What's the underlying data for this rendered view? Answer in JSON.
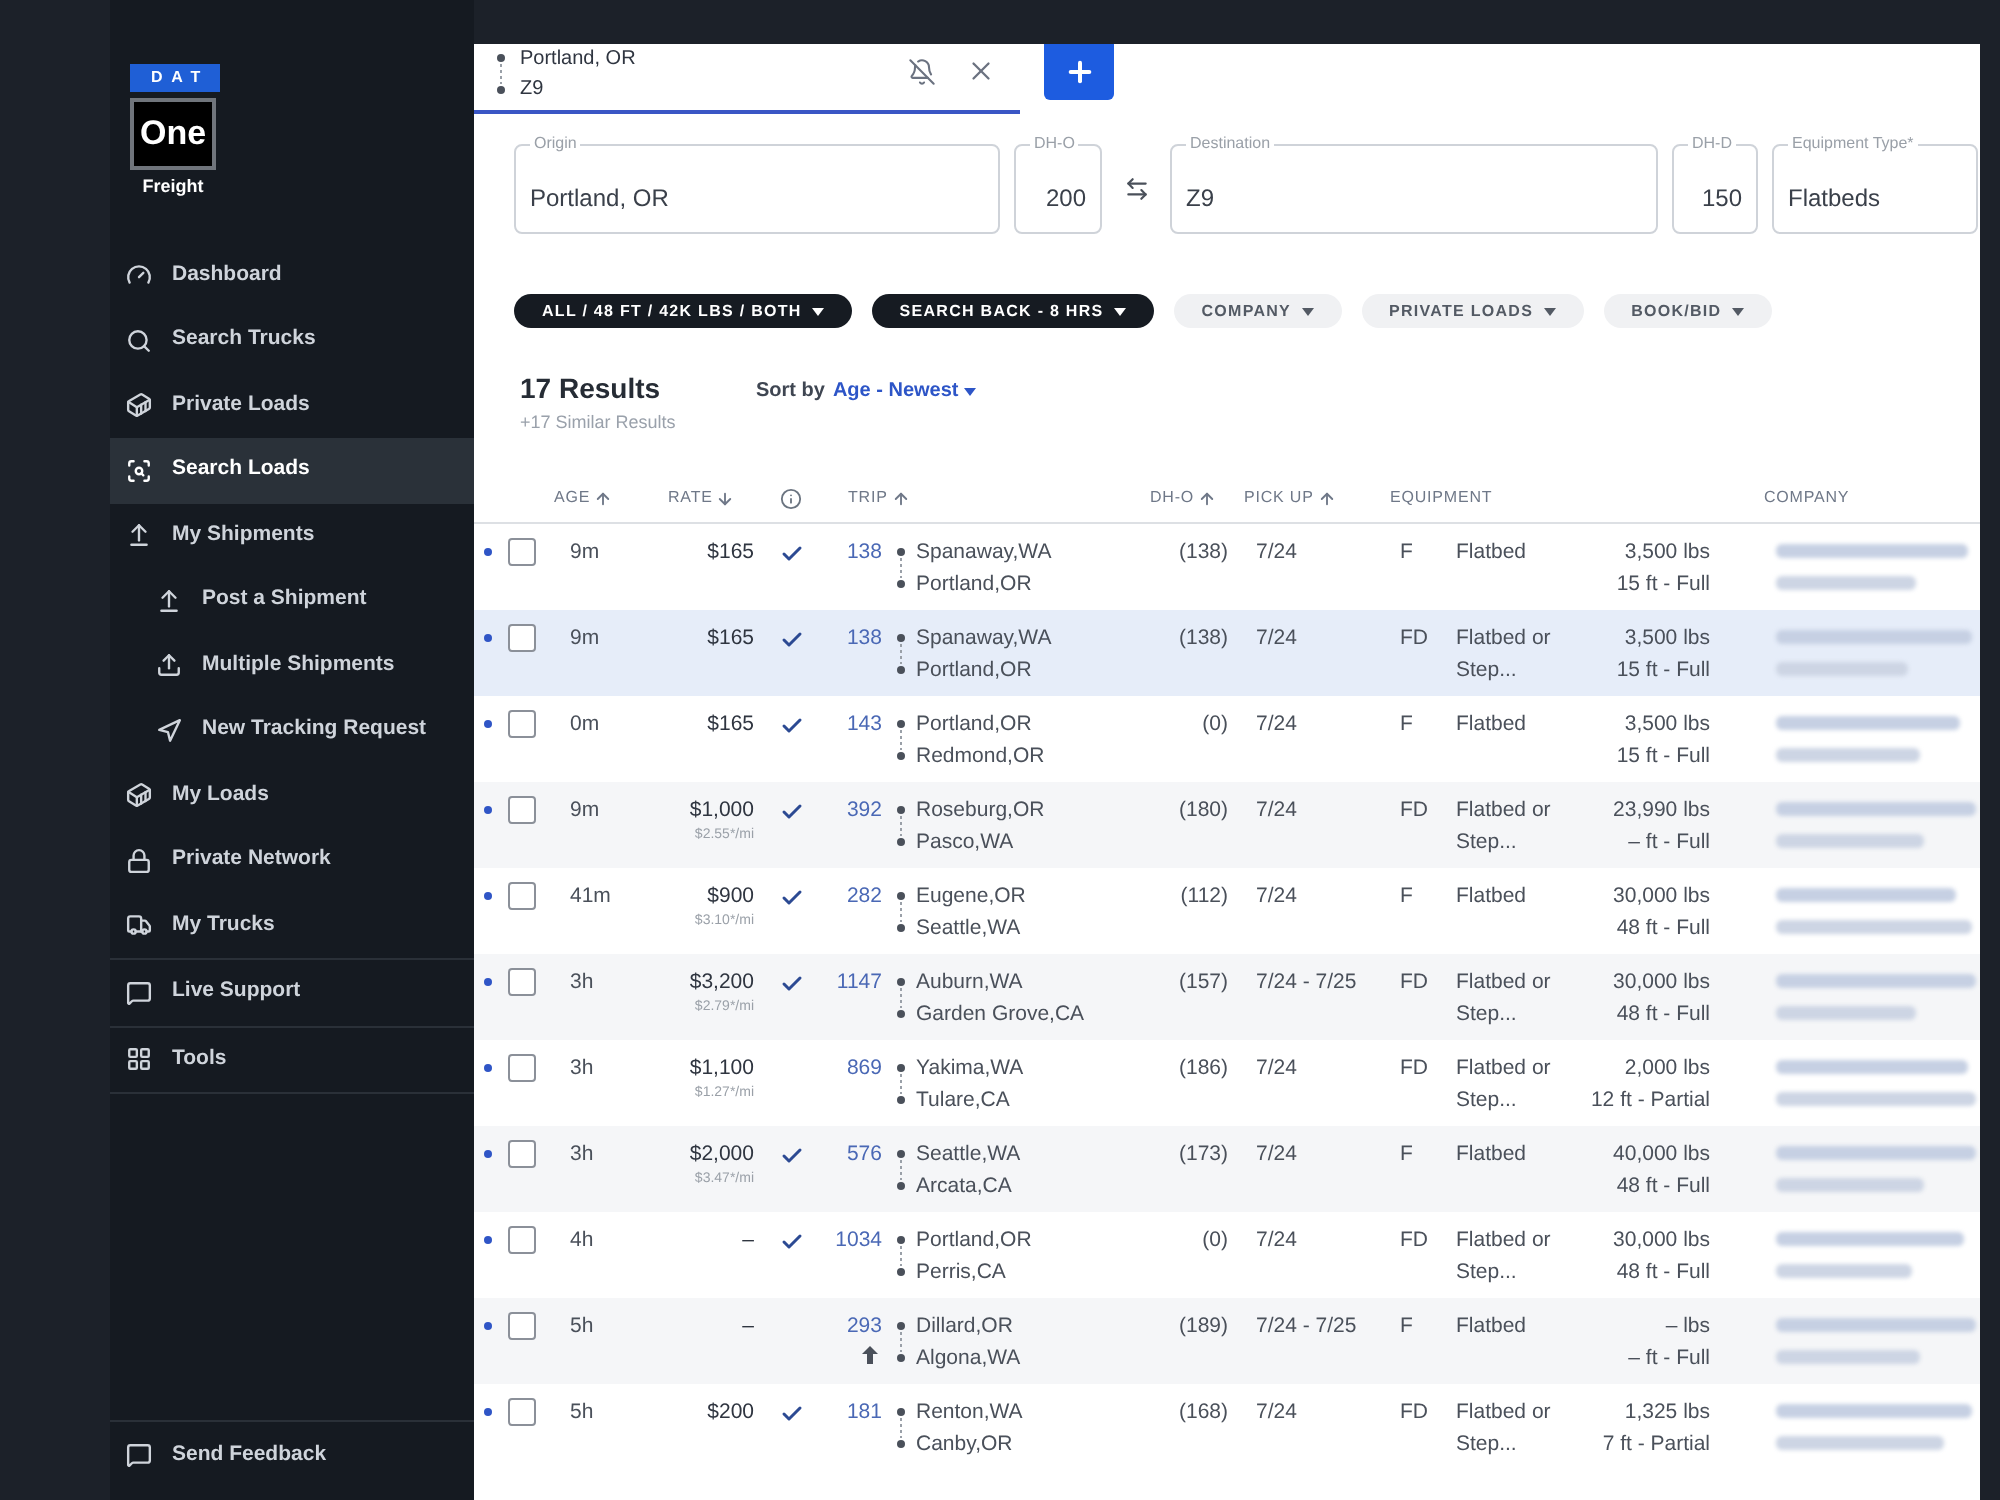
{
  "logo": {
    "brand": "DAT",
    "product": "One",
    "tagline": "Freight"
  },
  "sidebar": {
    "sections": [
      {
        "items": [
          {
            "label": "Dashboard",
            "selected": false
          },
          {
            "label": "Search Trucks",
            "selected": false
          },
          {
            "label": "Private Loads",
            "selected": false
          },
          {
            "label": "Search Loads",
            "selected": true
          },
          {
            "label": "My Shipments",
            "selected": false,
            "children": [
              {
                "label": "Post a Shipment",
                "selected": false
              },
              {
                "label": "Multiple Shipments",
                "selected": false
              },
              {
                "label": "New Tracking Request",
                "selected": false
              }
            ]
          },
          {
            "label": "My Loads",
            "selected": false
          },
          {
            "label": "Private Network",
            "selected": false
          },
          {
            "label": "My Trucks",
            "selected": false
          }
        ]
      },
      {
        "items": [
          {
            "label": "Live Support",
            "selected": false
          }
        ]
      },
      {
        "items": [
          {
            "label": "Tools",
            "selected": false
          }
        ]
      }
    ],
    "footer": {
      "label": "Send Feedback"
    }
  },
  "search_tabs": [
    {
      "origin": "Portland, OR",
      "destination": "Z9",
      "selected": true
    }
  ],
  "search_form": {
    "fields": [
      {
        "kind": "location",
        "label": "Origin",
        "value": "Portland, OR"
      },
      {
        "kind": "number",
        "label": "DH-O",
        "value": "200"
      },
      {
        "kind": "location",
        "label": "Destination",
        "value": "Z9"
      },
      {
        "kind": "number",
        "label": "DH-D",
        "value": "150"
      },
      {
        "kind": "select",
        "label": "Equipment Type*",
        "value": "Flatbeds"
      }
    ]
  },
  "filters": [
    {
      "label": "ALL / 48 FT / 42K LBS / BOTH",
      "active": true
    },
    {
      "label": "SEARCH BACK - 8 HRS",
      "active": true
    },
    {
      "label": "COMPANY",
      "active": false
    },
    {
      "label": "PRIVATE LOADS",
      "active": false
    },
    {
      "label": "BOOK/BID",
      "active": false
    }
  ],
  "results": {
    "count": "17 Results",
    "similar": "+17 Similar Results",
    "sort_label": "Sort by",
    "sort_value": "Age - Newest"
  },
  "table": {
    "columns": [
      {
        "kind": "text",
        "label": "AGE",
        "arrow_up": true,
        "arrow_down": false
      },
      {
        "kind": "text",
        "label": "RATE",
        "arrow_up": false,
        "arrow_down": true
      },
      {
        "kind": "icon"
      },
      {
        "kind": "text",
        "label": "TRIP",
        "arrow_up": true,
        "arrow_down": false
      },
      {
        "kind": "text",
        "label": "DH-O",
        "arrow_up": true,
        "arrow_down": false
      },
      {
        "kind": "text",
        "label": "PICK UP",
        "arrow_up": true,
        "arrow_down": false
      },
      {
        "kind": "text",
        "label": "EQUIPMENT",
        "arrow_up": false,
        "arrow_down": false
      },
      {
        "kind": "text",
        "label": "COMPANY",
        "arrow_up": false,
        "arrow_down": false
      }
    ],
    "rows": [
      {
        "unread": true,
        "checked": false,
        "selected": false,
        "age": "9m",
        "rate": "$165",
        "verified": true,
        "trip": "138",
        "marker": false,
        "origin": "Spanaway,WA",
        "destination": "Portland,OR",
        "dh_o": "(138)",
        "pickup": "7/24",
        "equipment_code": "F",
        "equipment": "Flatbed",
        "weight": "3,500 lbs",
        "length": "15 ft - Full"
      },
      {
        "unread": true,
        "checked": false,
        "selected": true,
        "age": "9m",
        "rate": "$165",
        "verified": true,
        "trip": "138",
        "marker": false,
        "origin": "Spanaway,WA",
        "destination": "Portland,OR",
        "dh_o": "(138)",
        "pickup": "7/24",
        "equipment_code": "FD",
        "equipment": "Flatbed or Step...",
        "weight": "3,500 lbs",
        "length": "15 ft - Full"
      },
      {
        "unread": true,
        "checked": false,
        "selected": false,
        "age": "0m",
        "rate": "$165",
        "verified": true,
        "trip": "143",
        "marker": false,
        "origin": "Portland,OR",
        "destination": "Redmond,OR",
        "dh_o": "(0)",
        "pickup": "7/24",
        "equipment_code": "F",
        "equipment": "Flatbed",
        "weight": "3,500 lbs",
        "length": "15 ft - Full"
      },
      {
        "unread": true,
        "checked": false,
        "selected": false,
        "age": "9m",
        "rate": "$1,000",
        "rate_per_mile": "$2.55*/mi",
        "verified": true,
        "trip": "392",
        "marker": false,
        "origin": "Roseburg,OR",
        "destination": "Pasco,WA",
        "dh_o": "(180)",
        "pickup": "7/24",
        "equipment_code": "FD",
        "equipment": "Flatbed or Step...",
        "weight": "23,990 lbs",
        "length": "– ft - Full"
      },
      {
        "unread": true,
        "checked": false,
        "selected": false,
        "age": "41m",
        "rate": "$900",
        "rate_per_mile": "$3.10*/mi",
        "verified": true,
        "trip": "282",
        "marker": false,
        "origin": "Eugene,OR",
        "destination": "Seattle,WA",
        "dh_o": "(112)",
        "pickup": "7/24",
        "equipment_code": "F",
        "equipment": "Flatbed",
        "weight": "30,000 lbs",
        "length": "48 ft - Full"
      },
      {
        "unread": true,
        "checked": false,
        "selected": false,
        "age": "3h",
        "rate": "$3,200",
        "rate_per_mile": "$2.79*/mi",
        "verified": true,
        "trip": "1147",
        "marker": false,
        "origin": "Auburn,WA",
        "destination": "Garden Grove,CA",
        "dh_o": "(157)",
        "pickup": "7/24 - 7/25",
        "equipment_code": "FD",
        "equipment": "Flatbed or Step...",
        "weight": "30,000 lbs",
        "length": "48 ft - Full"
      },
      {
        "unread": true,
        "checked": false,
        "selected": false,
        "age": "3h",
        "rate": "$1,100",
        "rate_per_mile": "$1.27*/mi",
        "verified": false,
        "trip": "869",
        "marker": false,
        "origin": "Yakima,WA",
        "destination": "Tulare,CA",
        "dh_o": "(186)",
        "pickup": "7/24",
        "equipment_code": "FD",
        "equipment": "Flatbed or Step...",
        "weight": "2,000 lbs",
        "length": "12 ft - Partial"
      },
      {
        "unread": true,
        "checked": false,
        "selected": false,
        "age": "3h",
        "rate": "$2,000",
        "rate_per_mile": "$3.47*/mi",
        "verified": true,
        "trip": "576",
        "marker": false,
        "origin": "Seattle,WA",
        "destination": "Arcata,CA",
        "dh_o": "(173)",
        "pickup": "7/24",
        "equipment_code": "F",
        "equipment": "Flatbed",
        "weight": "40,000 lbs",
        "length": "48 ft - Full"
      },
      {
        "unread": true,
        "checked": false,
        "selected": false,
        "age": "4h",
        "rate": "–",
        "verified": true,
        "trip": "1034",
        "marker": false,
        "origin": "Portland,OR",
        "destination": "Perris,CA",
        "dh_o": "(0)",
        "pickup": "7/24",
        "equipment_code": "FD",
        "equipment": "Flatbed or Step...",
        "weight": "30,000 lbs",
        "length": "48 ft - Full"
      },
      {
        "unread": true,
        "checked": false,
        "selected": false,
        "age": "5h",
        "rate": "–",
        "verified": false,
        "trip": "293",
        "marker": true,
        "origin": "Dillard,OR",
        "destination": "Algona,WA",
        "dh_o": "(189)",
        "pickup": "7/24 - 7/25",
        "equipment_code": "F",
        "equipment": "Flatbed",
        "weight": "– lbs",
        "length": "– ft - Full"
      },
      {
        "unread": true,
        "checked": false,
        "selected": false,
        "age": "5h",
        "rate": "$200",
        "verified": true,
        "trip": "181",
        "marker": false,
        "origin": "Renton,WA",
        "destination": "Canby,OR",
        "dh_o": "(168)",
        "pickup": "7/24",
        "equipment_code": "FD",
        "equipment": "Flatbed or Step...",
        "weight": "1,325 lbs",
        "length": "7 ft - Partial"
      }
    ]
  }
}
